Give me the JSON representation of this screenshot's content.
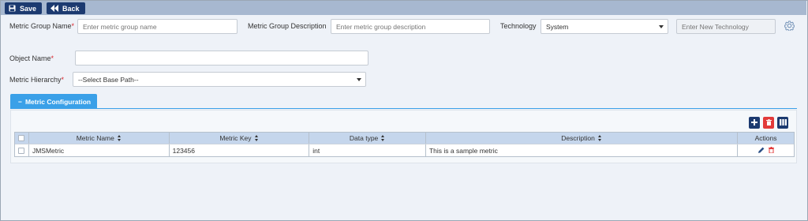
{
  "toolbar": {
    "save_label": "Save",
    "back_label": "Back"
  },
  "form": {
    "metric_group_name": {
      "label": "Metric Group Name",
      "placeholder": "Enter metric group name"
    },
    "metric_group_description": {
      "label": "Metric Group Description",
      "placeholder": "Enter metric group description"
    },
    "technology": {
      "label": "Technology",
      "value": "System",
      "new_placeholder": "Enter New Technology"
    },
    "object_name": {
      "label": "Object Name",
      "value": ""
    },
    "metric_hierarchy": {
      "label": "Metric Hierarchy",
      "value": "--Select Base Path--"
    },
    "required_mark": "*"
  },
  "section": {
    "tab_symbol": "−",
    "tab_label": "Metric Configuration"
  },
  "table": {
    "columns": [
      "Metric Name",
      "Metric Key",
      "Data type",
      "Description",
      "Actions"
    ],
    "rows": [
      {
        "metric_name": "JMSMetric",
        "metric_key": "123456",
        "data_type": "int",
        "description": "This is a sample metric"
      }
    ]
  },
  "icons": {
    "save": "save-icon",
    "back": "double-left-arrow-icon",
    "settings": "gear-icon",
    "add": "plus-icon",
    "delete": "trash-icon",
    "columns": "columns-icon",
    "edit": "pencil-icon"
  },
  "colors": {
    "toolbar_button": "#1c3a70",
    "tab_accent": "#3aa0e8",
    "delete_red": "#e23a3a",
    "header_row": "#c5d6ec"
  }
}
